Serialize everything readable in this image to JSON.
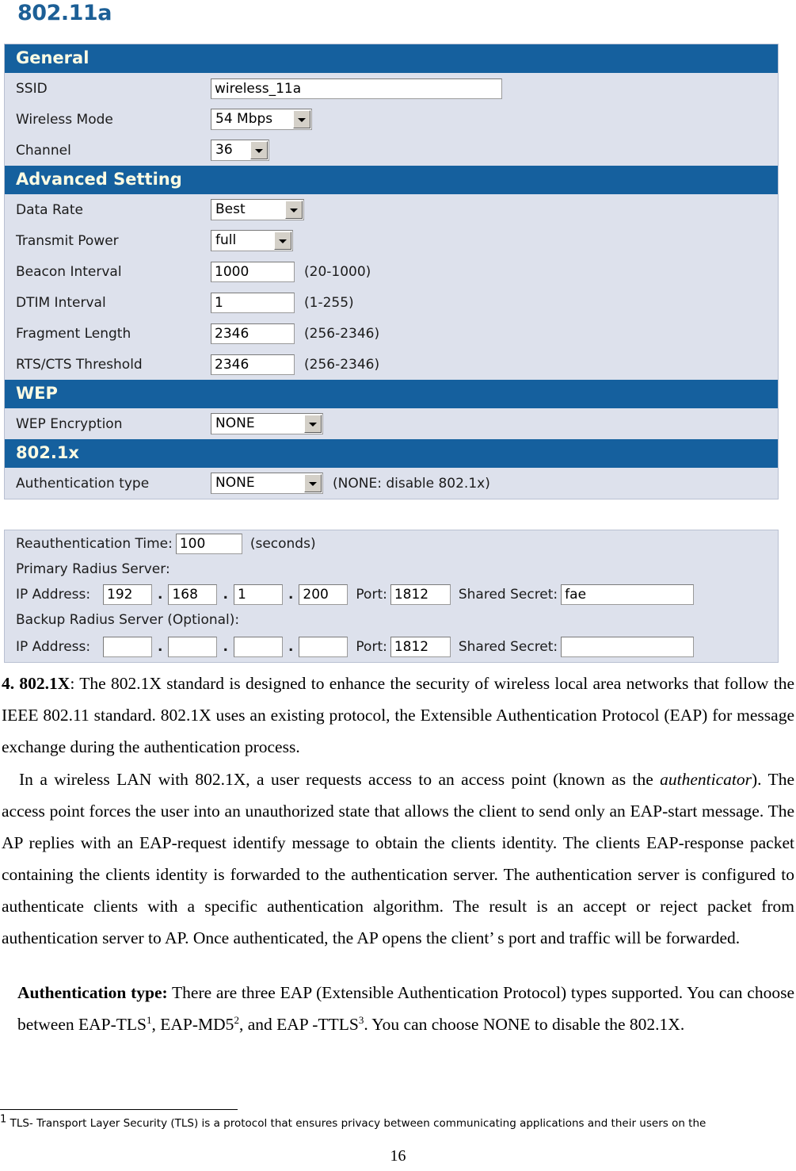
{
  "page_title": "802.11a",
  "panel_main": {
    "sections": [
      {
        "band": "General",
        "rows": [
          {
            "label": "SSID",
            "control": "text",
            "value": "wireless_11a"
          },
          {
            "label": "Wireless Mode",
            "control": "select",
            "value": "54 Mbps"
          },
          {
            "label": "Channel",
            "control": "select",
            "value": "36"
          }
        ]
      },
      {
        "band": "Advanced Setting",
        "rows": [
          {
            "label": "Data Rate",
            "control": "select",
            "value": "Best"
          },
          {
            "label": "Transmit Power",
            "control": "select",
            "value": "full"
          },
          {
            "label": "Beacon Interval",
            "control": "text",
            "value": "1000",
            "hint": "(20-1000)"
          },
          {
            "label": "DTIM Interval",
            "control": "text",
            "value": "1",
            "hint": "(1-255)"
          },
          {
            "label": "Fragment Length",
            "control": "text",
            "value": "2346",
            "hint": "(256-2346)"
          },
          {
            "label": "RTS/CTS Threshold",
            "control": "text",
            "value": "2346",
            "hint": "(256-2346)"
          }
        ]
      },
      {
        "band": "WEP",
        "rows": [
          {
            "label": "WEP Encryption",
            "control": "select",
            "value": "NONE"
          }
        ]
      },
      {
        "band": "802.1x",
        "rows": [
          {
            "label": "Authentication type",
            "control": "select",
            "value": "NONE",
            "hint": "(NONE: disable 802.1x)"
          }
        ]
      }
    ]
  },
  "panel_radius": {
    "reauth_label": "Reauthentication Time:",
    "reauth_value": "100",
    "reauth_units": "(seconds)",
    "primary_heading": "Primary Radius Server:",
    "backup_heading": "Backup Radius Server (Optional):",
    "ip_label": "IP Address:",
    "port_label": "Port:",
    "secret_label": "Shared Secret:",
    "primary": {
      "octets": [
        "192",
        "168",
        "1",
        "200"
      ],
      "port": "1812",
      "secret": "fae"
    },
    "backup": {
      "octets": [
        "",
        "",
        "",
        ""
      ],
      "port": "1812",
      "secret": ""
    }
  },
  "body": {
    "para1_lead": "4. 802.1X",
    "para1_rest": ": The 802.1X standard is designed to enhance the security of wireless local area networks that follow the IEEE 802.11 standard. 802.1X uses an existing protocol, the Extensible Authentication Protocol (EAP) for message exchange during the authentication process.",
    "para2_a": "In a wireless LAN with 802.1X, a user requests access to an access point (known as the ",
    "para2_italic": "authenticator",
    "para2_b": "). The access point forces the user into an unauthorized state that allows the client to send only an EAP-start message. The AP replies with an EAP-request identify message to obtain the clients identity. The clients EAP-response packet containing the clients identity is forwarded to the authentication server. The authentication server is configured to authenticate clients with a specific authentication algorithm. The result is an accept or reject packet from authentication server to AP. Once authenticated, the AP opens the client’ s port and traffic will be forwarded.",
    "para3_lead": "Authentication type:",
    "para3_a": " There are three EAP (Extensible Authentication Protocol) types supported. You can choose between EAP-TLS",
    "para3_sup1": "1",
    "para3_b": ", EAP-MD5",
    "para3_sup2": "2",
    "para3_c": ", and EAP -TTLS",
    "para3_sup3": "3",
    "para3_d": ". You can choose NONE to disable the 802.1X."
  },
  "footnote": {
    "marker": "1",
    "text": " TLS- Transport Layer Security (TLS) is a protocol that ensures privacy between communicating applications and their users on the"
  },
  "page_number": "16"
}
